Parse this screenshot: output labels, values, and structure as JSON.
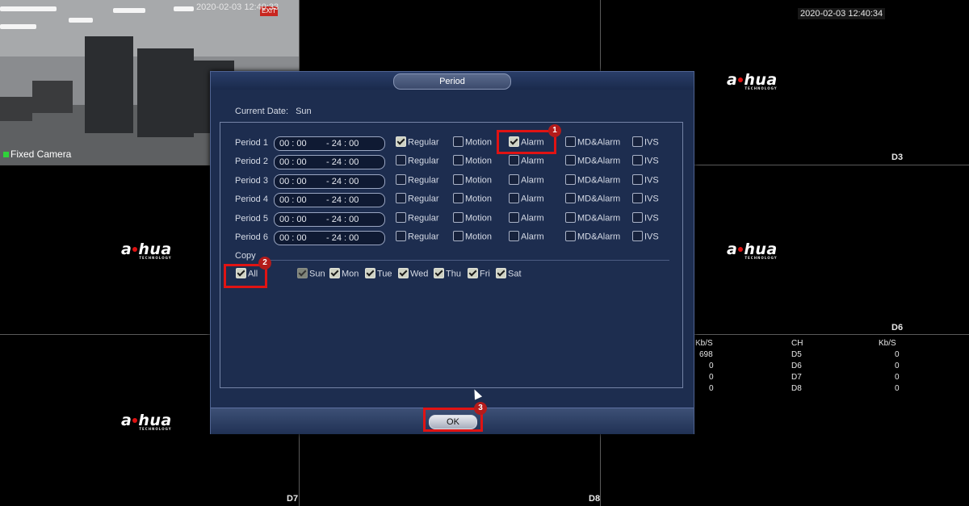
{
  "tiles": {
    "top_left": {
      "timestamp": "2020-02-03 12:40:33",
      "camera_label": "Fixed Camera",
      "exit_sign": "EXIT"
    },
    "top_right": {
      "timestamp": "2020-02-03 12:40:34",
      "channel": "D3"
    },
    "mid_right": {
      "channel": "D6"
    },
    "bottom_left": {
      "channel": "D7"
    },
    "bottom_mid": {
      "channel": "D8"
    },
    "logo_text": "a",
    "logo_text2": "hua",
    "logo_sub": "TECHNOLOGY"
  },
  "stats": {
    "headers": [
      "Kb/S",
      "CH",
      "Kb/S"
    ],
    "rows": [
      {
        "kbs1": "698",
        "ch": "D5",
        "kbs2": "0"
      },
      {
        "kbs1": "0",
        "ch": "D6",
        "kbs2": "0"
      },
      {
        "kbs1": "0",
        "ch": "D7",
        "kbs2": "0"
      },
      {
        "kbs1": "0",
        "ch": "D8",
        "kbs2": "0"
      }
    ]
  },
  "dialog": {
    "title": "Period",
    "current_date_label": "Current Date:",
    "current_date_value": "Sun",
    "periods": [
      {
        "label": "Period 1",
        "start": "00 : 00",
        "end": "- 24 : 00",
        "regular": true,
        "motion": false,
        "alarm": true,
        "md_alarm": false,
        "ivs": false
      },
      {
        "label": "Period 2",
        "start": "00 : 00",
        "end": "- 24 : 00",
        "regular": false,
        "motion": false,
        "alarm": false,
        "md_alarm": false,
        "ivs": false
      },
      {
        "label": "Period 3",
        "start": "00 : 00",
        "end": "- 24 : 00",
        "regular": false,
        "motion": false,
        "alarm": false,
        "md_alarm": false,
        "ivs": false
      },
      {
        "label": "Period 4",
        "start": "00 : 00",
        "end": "- 24 : 00",
        "regular": false,
        "motion": false,
        "alarm": false,
        "md_alarm": false,
        "ivs": false
      },
      {
        "label": "Period 5",
        "start": "00 : 00",
        "end": "- 24 : 00",
        "regular": false,
        "motion": false,
        "alarm": false,
        "md_alarm": false,
        "ivs": false
      },
      {
        "label": "Period 6",
        "start": "00 : 00",
        "end": "- 24 : 00",
        "regular": false,
        "motion": false,
        "alarm": false,
        "md_alarm": false,
        "ivs": false
      }
    ],
    "type_labels": {
      "regular": "Regular",
      "motion": "Motion",
      "alarm": "Alarm",
      "md_alarm": "MD&Alarm",
      "ivs": "IVS"
    },
    "copy": {
      "label": "Copy",
      "all_label": "All",
      "all_checked": true,
      "days": [
        {
          "label": "Sun",
          "checked": true,
          "disabled": true
        },
        {
          "label": "Mon",
          "checked": true,
          "disabled": false
        },
        {
          "label": "Tue",
          "checked": true,
          "disabled": false
        },
        {
          "label": "Wed",
          "checked": true,
          "disabled": false
        },
        {
          "label": "Thu",
          "checked": true,
          "disabled": false
        },
        {
          "label": "Fri",
          "checked": true,
          "disabled": false
        },
        {
          "label": "Sat",
          "checked": true,
          "disabled": false
        }
      ]
    },
    "ok_label": "OK"
  },
  "annotations": [
    "1",
    "2",
    "3"
  ],
  "colors": {
    "highlight": "#e01313",
    "badge": "#b31b1b",
    "dialog_bg": "#1d2d4f"
  }
}
